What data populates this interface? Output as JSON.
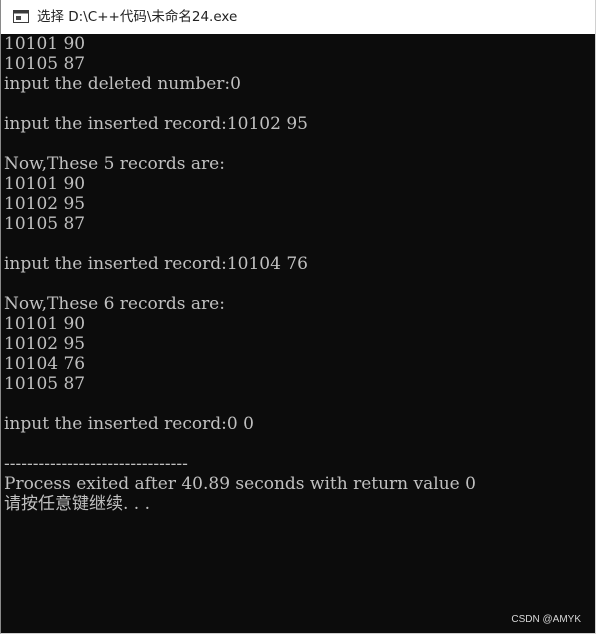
{
  "window": {
    "title": "选择 D:\\C++代码\\未命名24.exe",
    "icon": "console-window-icon"
  },
  "console": {
    "background": "#0c0c0c",
    "text_color": "#c0c0c0",
    "lines": [
      "10101 90",
      "10105 87",
      "input the deleted number:0",
      "",
      "input the inserted record:10102 95",
      "",
      "Now,These 5 records are:",
      "10101 90",
      "10102 95",
      "10105 87",
      "",
      "input the inserted record:10104 76",
      "",
      "Now,These 6 records are:",
      "10101 90",
      "10102 95",
      "10104 76",
      "10105 87",
      "",
      "input the inserted record:0 0",
      "",
      "--------------------------------",
      "Process exited after 40.89 seconds with return value 0",
      "请按任意键继续. . ."
    ]
  },
  "watermark": "CSDN @AMYK"
}
